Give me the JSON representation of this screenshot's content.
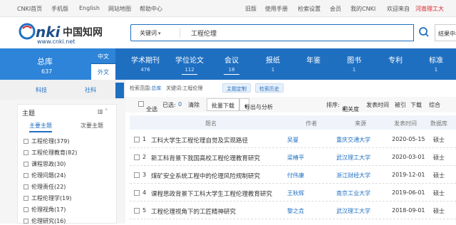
{
  "topbar": {
    "links": [
      "CNKI首页",
      "手机版",
      "English",
      "网站地图",
      "帮助中心"
    ],
    "right": [
      "旧版",
      "使用手册",
      "检索设置",
      "会员",
      "我的CNKI",
      "欢迎来自",
      "河南理工大"
    ]
  },
  "header": {
    "logo_text": "中国知网",
    "logo_url": "www.cnki.net",
    "search_field": "关键词",
    "search_query": "工程伦理",
    "right_button": "结果中检索"
  },
  "nav": {
    "total_label": "总库",
    "total_count": "637",
    "lang_cn": "中文",
    "lang_en": "外文",
    "items": [
      {
        "label": "学术期刊",
        "count": "476"
      },
      {
        "label": "学位论文",
        "count": "112"
      },
      {
        "label": "会议",
        "count": "18"
      },
      {
        "label": "报纸",
        "count": "1"
      },
      {
        "label": "年鉴",
        "count": ""
      },
      {
        "label": "图书",
        "count": "1"
      },
      {
        "label": "专利",
        "count": ""
      },
      {
        "label": "标准",
        "count": "1"
      }
    ]
  },
  "sidebar": {
    "tabs": [
      "科技",
      "社科"
    ],
    "panel_title": "主题",
    "subtabs": [
      "主要主题",
      "次要主题"
    ],
    "topics": [
      "工程伦理(379)",
      "工程伦理教育(82)",
      "课程思政(30)",
      "伦理问题(24)",
      "伦理责任(22)",
      "工程伦理学(19)",
      "伦理视角(17)",
      "伦理研究(16)"
    ]
  },
  "main": {
    "crumb_scope_label": "检索范围:",
    "crumb_scope": "总库",
    "crumb_kw_label": "关键词:",
    "crumb_kw": "工程伦理",
    "pill_custom": "主题定制",
    "pill_history": "检索历史",
    "toolbar": {
      "select_all": "全选",
      "selected": "已选:",
      "selected_count": "0",
      "clear": "清除",
      "batch_download": "批量下载",
      "export": "导出与分析",
      "sort_label": "排序:",
      "sort_relevance": "相关度",
      "sort_date": "发表时间",
      "sort_cite": "被引",
      "sort_download": "下载",
      "sort_overall": "综合"
    },
    "columns": [
      "题名",
      "作者",
      "来源",
      "发表时间",
      "数据库"
    ],
    "rows": [
      {
        "no": "1",
        "title": "工科大学生工程伦理自觉及实现路径",
        "author": "吴曼",
        "source": "重庆交通大学",
        "date": "2020-05-15",
        "db": "硕士"
      },
      {
        "no": "2",
        "title": "新工科背景下我国高校工程伦理教育研究",
        "author": "梁椿平",
        "source": "武汉理工大学",
        "date": "2020-03-01",
        "db": "硕士"
      },
      {
        "no": "3",
        "title": "煤矿安全系统工程中的伦理风险规制研究",
        "author": "付伟康",
        "source": "浙江财经大学",
        "date": "2019-12-01",
        "db": "硕士"
      },
      {
        "no": "4",
        "title": "课程思政背景下工科大学生工程伦理教育研究",
        "author": "王秋辉",
        "source": "南京工业大学",
        "date": "2019-06-01",
        "db": "硕士"
      },
      {
        "no": "5",
        "title": "工程伦理视角下的工匠精神研究",
        "author": "黎之垚",
        "source": "武汉理工大学",
        "date": "2018-09-01",
        "db": "硕士"
      }
    ]
  }
}
